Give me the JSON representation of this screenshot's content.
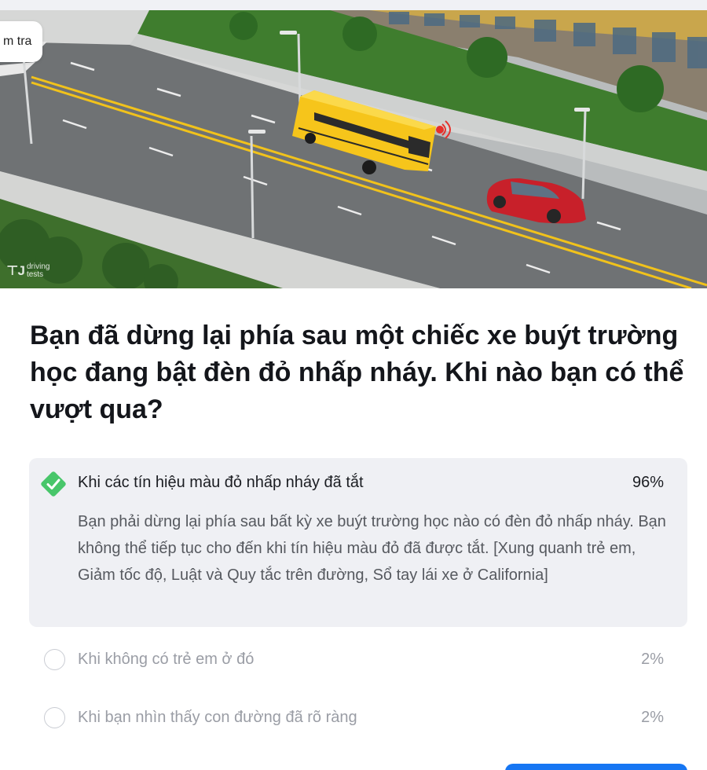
{
  "check_button": {
    "label": "m tra"
  },
  "illustration": {
    "watermark_line1": "driving",
    "watermark_line2": "tests",
    "colors": {
      "bus": "#f6c51b",
      "car": "#c8202a",
      "grass": "#3f7d2e",
      "road": "#6f7274"
    }
  },
  "question": {
    "text": "Bạn đã dừng lại phía sau một chiếc xe buýt trường học đang bật đèn đỏ nhấp nháy. Khi nào bạn có thể vượt qua?"
  },
  "answers": [
    {
      "label": "Khi các tín hiệu màu đỏ nhấp nháy đã tắt",
      "percent": "96%",
      "correct": true,
      "explanation": "Bạn phải dừng lại phía sau bất kỳ xe buýt trường học nào có đèn đỏ nhấp nháy. Bạn không thể tiếp tục cho đến khi tín hiệu màu đỏ đã được tắt. [Xung quanh trẻ em, Giảm tốc độ, Luật và Quy tắc trên đường, Sổ tay lái xe ở California]"
    },
    {
      "label": "Khi không có trẻ em ở đó",
      "percent": "2%",
      "correct": false
    },
    {
      "label": "Khi bạn nhìn thấy con đường đã rõ ràng",
      "percent": "2%",
      "correct": false
    }
  ],
  "colors": {
    "correct_green": "#48c66a",
    "next_button": "#1676f3",
    "answer_bg": "#eff0f4"
  }
}
